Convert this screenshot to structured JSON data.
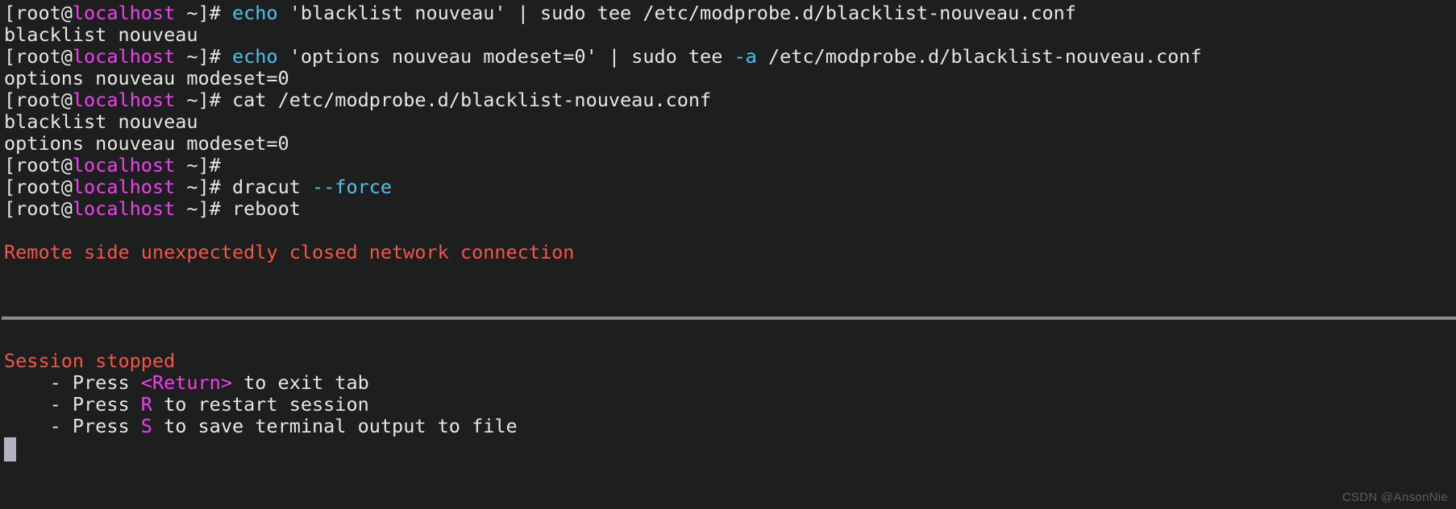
{
  "terminal": {
    "background_color": "#1d1e1e",
    "default_text_color": "#e8e6e3",
    "prompt_host_color": "#f03ff0",
    "command_flag_color": "#4ec3e8",
    "error_color": "#f4554a",
    "divider_color": "#8c8c8c",
    "cursor_color": "#b3b3c2",
    "prompt": {
      "prefix": "[root@",
      "host": "localhost",
      "suffix": " ~]#"
    },
    "lines": [
      {
        "type": "command",
        "segments": [
          {
            "text": "[root@",
            "color": "white"
          },
          {
            "text": "localhost",
            "color": "magenta"
          },
          {
            "text": " ~]# ",
            "color": "white"
          },
          {
            "text": "echo",
            "color": "cyan"
          },
          {
            "text": " 'blacklist nouveau' | sudo tee /etc/modprobe.d/blacklist-nouveau.conf",
            "color": "white"
          }
        ]
      },
      {
        "type": "output",
        "segments": [
          {
            "text": "blacklist nouveau",
            "color": "white"
          }
        ]
      },
      {
        "type": "command",
        "segments": [
          {
            "text": "[root@",
            "color": "white"
          },
          {
            "text": "localhost",
            "color": "magenta"
          },
          {
            "text": " ~]# ",
            "color": "white"
          },
          {
            "text": "echo",
            "color": "cyan"
          },
          {
            "text": " 'options nouveau modeset=0' | sudo tee ",
            "color": "white"
          },
          {
            "text": "-a",
            "color": "cyan"
          },
          {
            "text": " /etc/modprobe.d/blacklist-nouveau.conf",
            "color": "white"
          }
        ]
      },
      {
        "type": "output",
        "segments": [
          {
            "text": "options nouveau modeset=0",
            "color": "white"
          }
        ]
      },
      {
        "type": "command",
        "segments": [
          {
            "text": "[root@",
            "color": "white"
          },
          {
            "text": "localhost",
            "color": "magenta"
          },
          {
            "text": " ~]# cat /etc/modprobe.d/blacklist-nouveau.conf",
            "color": "white"
          }
        ]
      },
      {
        "type": "output",
        "segments": [
          {
            "text": "blacklist nouveau",
            "color": "white"
          }
        ]
      },
      {
        "type": "output",
        "segments": [
          {
            "text": "options nouveau modeset=0",
            "color": "white"
          }
        ]
      },
      {
        "type": "command",
        "segments": [
          {
            "text": "[root@",
            "color": "white"
          },
          {
            "text": "localhost",
            "color": "magenta"
          },
          {
            "text": " ~]#",
            "color": "white"
          }
        ]
      },
      {
        "type": "command",
        "segments": [
          {
            "text": "[root@",
            "color": "white"
          },
          {
            "text": "localhost",
            "color": "magenta"
          },
          {
            "text": " ~]# dracut ",
            "color": "white"
          },
          {
            "text": "--force",
            "color": "cyan"
          }
        ]
      },
      {
        "type": "command",
        "segments": [
          {
            "text": "[root@",
            "color": "white"
          },
          {
            "text": "localhost",
            "color": "magenta"
          },
          {
            "text": " ~]# reboot",
            "color": "white"
          }
        ]
      },
      {
        "type": "blank",
        "segments": []
      },
      {
        "type": "error",
        "segments": [
          {
            "text": "Remote side unexpectedly closed network connection",
            "color": "red"
          }
        ]
      },
      {
        "type": "blank",
        "segments": []
      },
      {
        "type": "blank",
        "segments": []
      },
      {
        "type": "divider",
        "segments": []
      },
      {
        "type": "blank",
        "segments": []
      },
      {
        "type": "status",
        "segments": [
          {
            "text": "Session stopped",
            "color": "red"
          }
        ]
      },
      {
        "type": "hint",
        "segments": [
          {
            "text": "    - Press ",
            "color": "white"
          },
          {
            "text": "<Return>",
            "color": "magenta"
          },
          {
            "text": " to exit tab",
            "color": "white"
          }
        ]
      },
      {
        "type": "hint",
        "segments": [
          {
            "text": "    - Press ",
            "color": "white"
          },
          {
            "text": "R",
            "color": "magenta"
          },
          {
            "text": " to restart session",
            "color": "white"
          }
        ]
      },
      {
        "type": "hint",
        "segments": [
          {
            "text": "    - Press ",
            "color": "white"
          },
          {
            "text": "S",
            "color": "magenta"
          },
          {
            "text": " to save terminal output to file",
            "color": "white"
          }
        ]
      }
    ],
    "watermark": "CSDN @AnsonNie"
  }
}
